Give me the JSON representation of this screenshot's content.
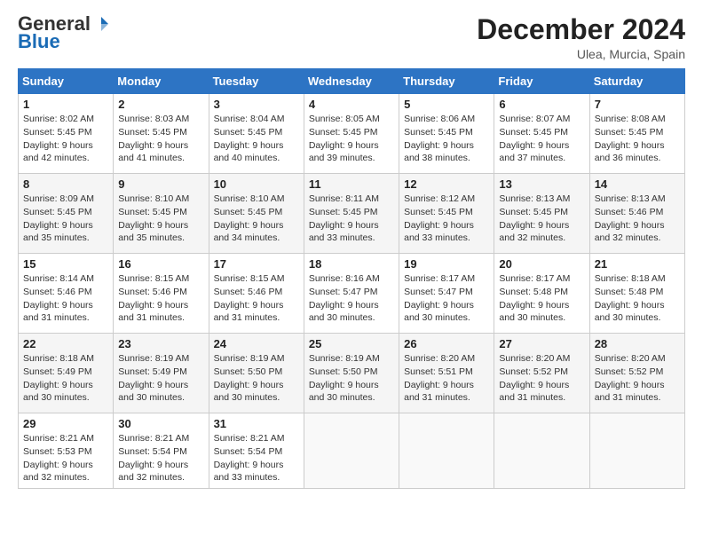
{
  "header": {
    "logo_general": "General",
    "logo_blue": "Blue",
    "month_title": "December 2024",
    "subtitle": "Ulea, Murcia, Spain"
  },
  "weekdays": [
    "Sunday",
    "Monday",
    "Tuesday",
    "Wednesday",
    "Thursday",
    "Friday",
    "Saturday"
  ],
  "weeks": [
    [
      {
        "day": "1",
        "sunrise": "Sunrise: 8:02 AM",
        "sunset": "Sunset: 5:45 PM",
        "daylight": "Daylight: 9 hours and 42 minutes."
      },
      {
        "day": "2",
        "sunrise": "Sunrise: 8:03 AM",
        "sunset": "Sunset: 5:45 PM",
        "daylight": "Daylight: 9 hours and 41 minutes."
      },
      {
        "day": "3",
        "sunrise": "Sunrise: 8:04 AM",
        "sunset": "Sunset: 5:45 PM",
        "daylight": "Daylight: 9 hours and 40 minutes."
      },
      {
        "day": "4",
        "sunrise": "Sunrise: 8:05 AM",
        "sunset": "Sunset: 5:45 PM",
        "daylight": "Daylight: 9 hours and 39 minutes."
      },
      {
        "day": "5",
        "sunrise": "Sunrise: 8:06 AM",
        "sunset": "Sunset: 5:45 PM",
        "daylight": "Daylight: 9 hours and 38 minutes."
      },
      {
        "day": "6",
        "sunrise": "Sunrise: 8:07 AM",
        "sunset": "Sunset: 5:45 PM",
        "daylight": "Daylight: 9 hours and 37 minutes."
      },
      {
        "day": "7",
        "sunrise": "Sunrise: 8:08 AM",
        "sunset": "Sunset: 5:45 PM",
        "daylight": "Daylight: 9 hours and 36 minutes."
      }
    ],
    [
      {
        "day": "8",
        "sunrise": "Sunrise: 8:09 AM",
        "sunset": "Sunset: 5:45 PM",
        "daylight": "Daylight: 9 hours and 35 minutes."
      },
      {
        "day": "9",
        "sunrise": "Sunrise: 8:10 AM",
        "sunset": "Sunset: 5:45 PM",
        "daylight": "Daylight: 9 hours and 35 minutes."
      },
      {
        "day": "10",
        "sunrise": "Sunrise: 8:10 AM",
        "sunset": "Sunset: 5:45 PM",
        "daylight": "Daylight: 9 hours and 34 minutes."
      },
      {
        "day": "11",
        "sunrise": "Sunrise: 8:11 AM",
        "sunset": "Sunset: 5:45 PM",
        "daylight": "Daylight: 9 hours and 33 minutes."
      },
      {
        "day": "12",
        "sunrise": "Sunrise: 8:12 AM",
        "sunset": "Sunset: 5:45 PM",
        "daylight": "Daylight: 9 hours and 33 minutes."
      },
      {
        "day": "13",
        "sunrise": "Sunrise: 8:13 AM",
        "sunset": "Sunset: 5:45 PM",
        "daylight": "Daylight: 9 hours and 32 minutes."
      },
      {
        "day": "14",
        "sunrise": "Sunrise: 8:13 AM",
        "sunset": "Sunset: 5:46 PM",
        "daylight": "Daylight: 9 hours and 32 minutes."
      }
    ],
    [
      {
        "day": "15",
        "sunrise": "Sunrise: 8:14 AM",
        "sunset": "Sunset: 5:46 PM",
        "daylight": "Daylight: 9 hours and 31 minutes."
      },
      {
        "day": "16",
        "sunrise": "Sunrise: 8:15 AM",
        "sunset": "Sunset: 5:46 PM",
        "daylight": "Daylight: 9 hours and 31 minutes."
      },
      {
        "day": "17",
        "sunrise": "Sunrise: 8:15 AM",
        "sunset": "Sunset: 5:46 PM",
        "daylight": "Daylight: 9 hours and 31 minutes."
      },
      {
        "day": "18",
        "sunrise": "Sunrise: 8:16 AM",
        "sunset": "Sunset: 5:47 PM",
        "daylight": "Daylight: 9 hours and 30 minutes."
      },
      {
        "day": "19",
        "sunrise": "Sunrise: 8:17 AM",
        "sunset": "Sunset: 5:47 PM",
        "daylight": "Daylight: 9 hours and 30 minutes."
      },
      {
        "day": "20",
        "sunrise": "Sunrise: 8:17 AM",
        "sunset": "Sunset: 5:48 PM",
        "daylight": "Daylight: 9 hours and 30 minutes."
      },
      {
        "day": "21",
        "sunrise": "Sunrise: 8:18 AM",
        "sunset": "Sunset: 5:48 PM",
        "daylight": "Daylight: 9 hours and 30 minutes."
      }
    ],
    [
      {
        "day": "22",
        "sunrise": "Sunrise: 8:18 AM",
        "sunset": "Sunset: 5:49 PM",
        "daylight": "Daylight: 9 hours and 30 minutes."
      },
      {
        "day": "23",
        "sunrise": "Sunrise: 8:19 AM",
        "sunset": "Sunset: 5:49 PM",
        "daylight": "Daylight: 9 hours and 30 minutes."
      },
      {
        "day": "24",
        "sunrise": "Sunrise: 8:19 AM",
        "sunset": "Sunset: 5:50 PM",
        "daylight": "Daylight: 9 hours and 30 minutes."
      },
      {
        "day": "25",
        "sunrise": "Sunrise: 8:19 AM",
        "sunset": "Sunset: 5:50 PM",
        "daylight": "Daylight: 9 hours and 30 minutes."
      },
      {
        "day": "26",
        "sunrise": "Sunrise: 8:20 AM",
        "sunset": "Sunset: 5:51 PM",
        "daylight": "Daylight: 9 hours and 31 minutes."
      },
      {
        "day": "27",
        "sunrise": "Sunrise: 8:20 AM",
        "sunset": "Sunset: 5:52 PM",
        "daylight": "Daylight: 9 hours and 31 minutes."
      },
      {
        "day": "28",
        "sunrise": "Sunrise: 8:20 AM",
        "sunset": "Sunset: 5:52 PM",
        "daylight": "Daylight: 9 hours and 31 minutes."
      }
    ],
    [
      {
        "day": "29",
        "sunrise": "Sunrise: 8:21 AM",
        "sunset": "Sunset: 5:53 PM",
        "daylight": "Daylight: 9 hours and 32 minutes."
      },
      {
        "day": "30",
        "sunrise": "Sunrise: 8:21 AM",
        "sunset": "Sunset: 5:54 PM",
        "daylight": "Daylight: 9 hours and 32 minutes."
      },
      {
        "day": "31",
        "sunrise": "Sunrise: 8:21 AM",
        "sunset": "Sunset: 5:54 PM",
        "daylight": "Daylight: 9 hours and 33 minutes."
      },
      null,
      null,
      null,
      null
    ]
  ]
}
